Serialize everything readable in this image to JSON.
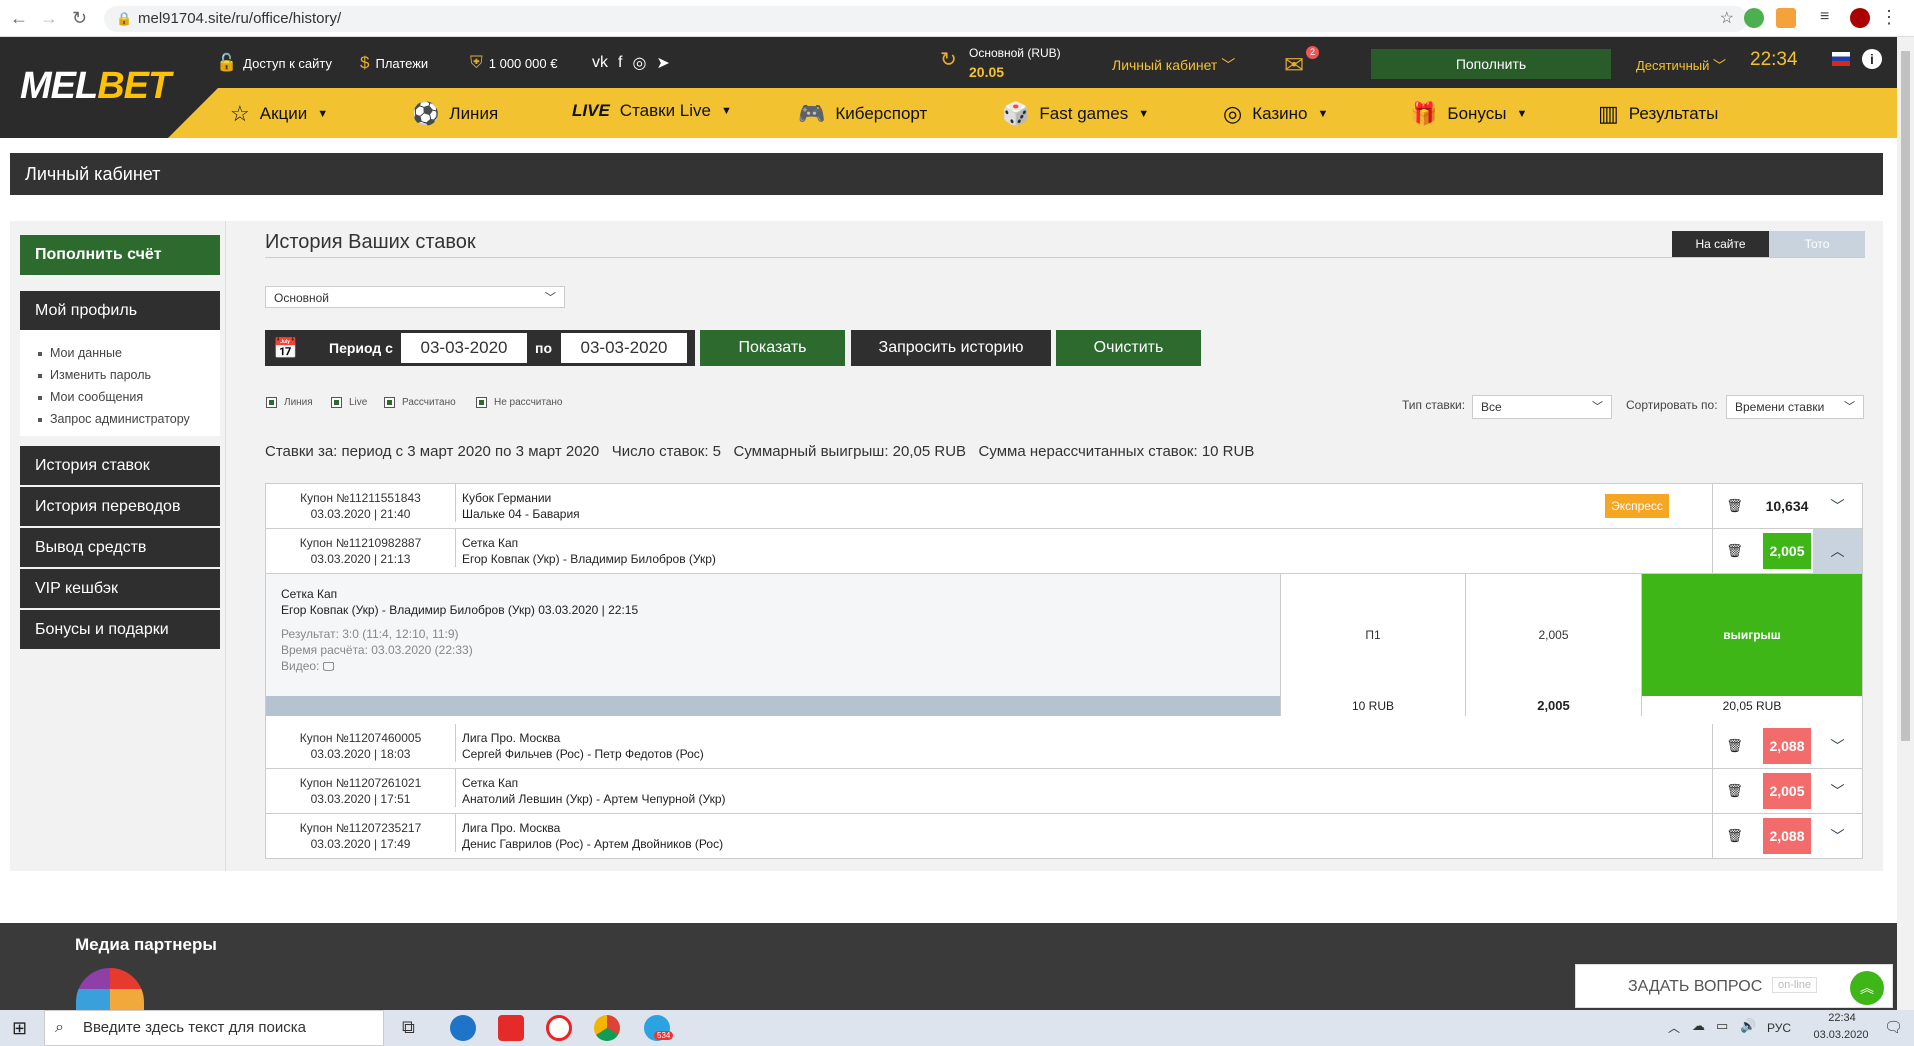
{
  "browser": {
    "url": "mel91704.site/ru/office/history/"
  },
  "header": {
    "logo": {
      "part1": "MEL",
      "part2": "BET"
    },
    "site_access": "Доступ к сайту",
    "payments": "Платежи",
    "jackpot": "1 000 000 €",
    "account_label": "Основной (RUB)",
    "balance": "20.05",
    "cabinet_link": "Личный кабинет",
    "mail_count": "2",
    "deposit_button": "Пополнить",
    "odds_format": "Десятичный",
    "time": "22:34"
  },
  "menu": {
    "items": [
      {
        "label": "Акции"
      },
      {
        "label": "Линия"
      },
      {
        "live": "LIVE",
        "label": "Ставки Live"
      },
      {
        "label": "Киберспорт"
      },
      {
        "label": "Fast games"
      },
      {
        "label": "Казино"
      },
      {
        "label": "Бонусы"
      },
      {
        "label": "Результаты"
      }
    ]
  },
  "cabinet_title": "Личный кабинет",
  "sidebar": {
    "deposit": "Пополнить счёт",
    "profile": "Мой профиль",
    "sub": [
      "Мои данные",
      "Изменить пароль",
      "Мои сообщения",
      "Запрос администратору"
    ],
    "items": [
      "История ставок",
      "История переводов",
      "Вывод средств",
      "VIP кешбэк",
      "Бонусы и подарки"
    ]
  },
  "main": {
    "title": "История Ваших ставок",
    "tab_site": "На сайте",
    "tab_toto": "Тото",
    "account_select": "Основной",
    "period_from_label": "Период с",
    "date_from": "03-03-2020",
    "period_to_label": "по",
    "date_to": "03-03-2020",
    "show_button": "Показать",
    "request_button": "Запросить историю",
    "clear_button": "Очистить",
    "checkboxes": [
      "Линия",
      "Live",
      "Рассчитано",
      "Не рассчитано"
    ],
    "bet_type_label": "Тип ставки:",
    "bet_type_value": "Все",
    "sort_label": "Сортировать по:",
    "sort_value": "Времени ставки",
    "summary": "Ставки за: период с 3 март 2020 по 3 март 2020   Число ставок: 5   Суммарный выигрыш: 20,05 RUB   Сумма нерассчитанных ставок: 10 RUB"
  },
  "bets": [
    {
      "coupon": "Купон №11211551843",
      "date": "03.03.2020 | 21:40",
      "league": "Кубок Германии",
      "match": "Шальке 04 - Бавария",
      "badge": "Экспресс",
      "coef": "10,634",
      "status_color": "#ffffff"
    },
    {
      "coupon": "Купон №11210982887",
      "date": "03.03.2020 | 21:13",
      "league": "Сетка Кап",
      "match": "Егор Ковпак (Укр) - Владимир Билобров (Укр)",
      "coef": "2,005",
      "status_color": "#3fb618"
    },
    {
      "coupon": "Купон №11207460005",
      "date": "03.03.2020 | 18:03",
      "league": "Лига Про. Москва",
      "match": "Сергей Фильчев (Рос) - Петр Федотов (Рос)",
      "coef": "2,088",
      "status_color": "#f36c6c"
    },
    {
      "coupon": "Купон №11207261021",
      "date": "03.03.2020 | 17:51",
      "league": "Сетка Кап",
      "match": "Анатолий Левшин (Укр) - Артем Чепурной (Укр)",
      "coef": "2,005",
      "status_color": "#f36c6c"
    },
    {
      "coupon": "Купон №11207235217",
      "date": "03.03.2020 | 17:49",
      "league": "Лига Про. Москва",
      "match": "Денис Гаврилов (Рос) - Артем Двойников (Рос)",
      "coef": "2,088",
      "status_color": "#f36c6c"
    }
  ],
  "detail": {
    "league": "Сетка Кап",
    "match": "Егор Ковпак (Укр) - Владимир Билобров (Укр) 03.03.2020 | 22:15",
    "result": "Результат: 3:0 (11:4, 12:10, 11:9)",
    "calc_time": "Время расчёта: 03.03.2020 (22:33)",
    "video": "Видео:",
    "outcome": "П1",
    "odds": "2,005",
    "status": "выигрыш",
    "stake": "10 RUB",
    "total_odds": "2,005",
    "payout": "20,05 RUB"
  },
  "footer": {
    "media_partners": "Медиа партнеры",
    "ask_question": "ЗАДАТЬ ВОПРОС",
    "online": "on-line"
  },
  "taskbar": {
    "search_placeholder": "Введите здесь текст для поиска",
    "lang": "РУС",
    "time": "22:34",
    "date": "03.03.2020",
    "telegram_badge": "534"
  }
}
